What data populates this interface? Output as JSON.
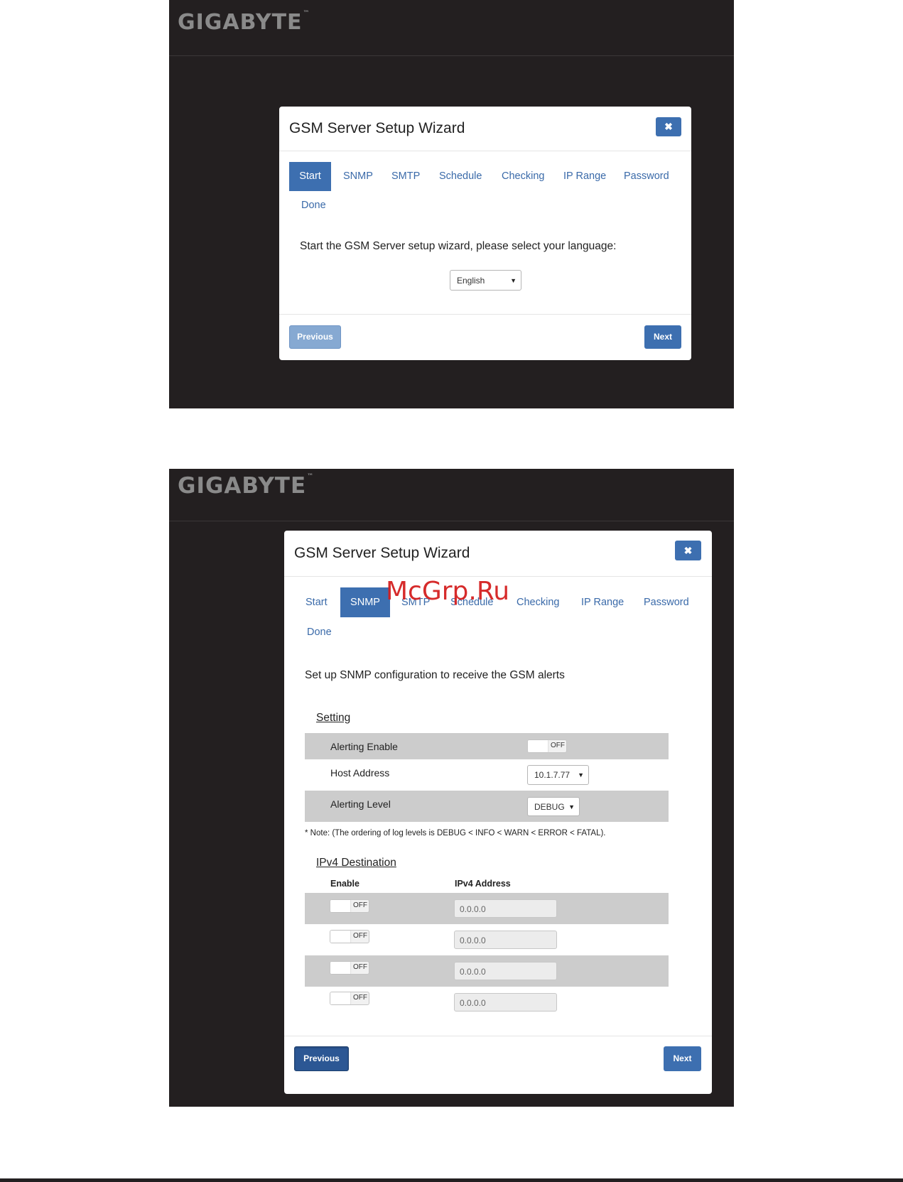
{
  "brand": {
    "logo": "GIGABYTE",
    "tm": "™"
  },
  "wizard_title": "GSM Server Setup Wizard",
  "close_symbol": "✖",
  "tabs": [
    "Start",
    "SNMP",
    "SMTP",
    "Schedule",
    "Checking",
    "IP Range",
    "Password",
    "Done"
  ],
  "screen1": {
    "active_tab": "Start",
    "prompt": "Start the GSM Server setup wizard, please select your language:",
    "language_select": "English",
    "previous_label": "Previous",
    "next_label": "Next"
  },
  "screen2": {
    "active_tab": "SNMP",
    "intro": "Set up SNMP configuration to receive the GSM alerts",
    "setting_heading": "Setting",
    "alerting_enable_label": "Alerting Enable",
    "alerting_enable_state": "OFF",
    "host_address_label": "Host Address",
    "host_address_value": "10.1.7.77",
    "alerting_level_label": "Alerting Level",
    "alerting_level_value": "DEBUG",
    "note": "* Note: (The ordering of log levels is DEBUG < INFO < WARN < ERROR < FATAL).",
    "ipv4_heading": "IPv4 Destination",
    "col_enable": "Enable",
    "col_address": "IPv4 Address",
    "destinations": [
      {
        "state": "OFF",
        "address": "0.0.0.0"
      },
      {
        "state": "OFF",
        "address": "0.0.0.0"
      },
      {
        "state": "OFF",
        "address": "0.0.0.0"
      },
      {
        "state": "OFF",
        "address": "0.0.0.0"
      }
    ],
    "previous_label": "Previous",
    "next_label": "Next"
  },
  "watermark": "McGrp.Ru",
  "colors": {
    "accent": "#3d6fb0",
    "background": "#231f20",
    "row_gray": "#cccccc",
    "watermark": "#d42020"
  }
}
